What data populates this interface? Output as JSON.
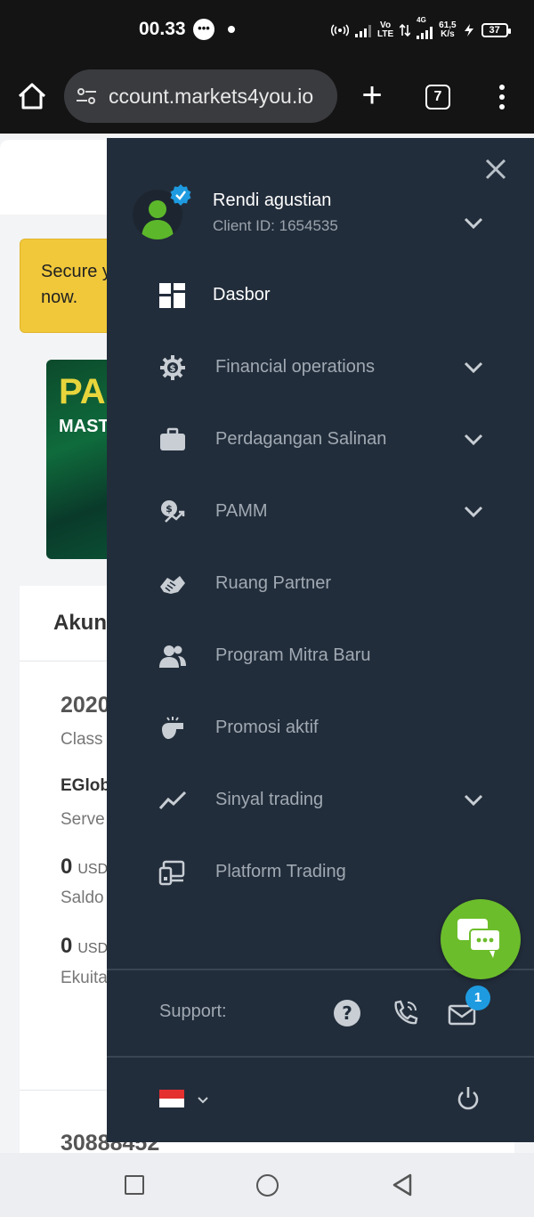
{
  "status_bar": {
    "time": "00.33",
    "network": "Vo\nLTE",
    "signal_type": "4G",
    "speed": "61,5\nK/s",
    "battery": "37"
  },
  "browser": {
    "url": "ccount.markets4you.io",
    "tab_count": "7"
  },
  "background_page": {
    "alert_text": "Secure y\nnow.",
    "banner_title": "PA",
    "banner_subtitle": "MAST",
    "card_title": "Akun",
    "accounts": [
      {
        "number": "2020",
        "type": "Class",
        "server_name": "EGlob",
        "server_label": "Serve",
        "balance": "0",
        "balance_currency": "USD",
        "balance_label": "Saldo",
        "equity": "0",
        "equity_currency": "USD",
        "equity_label": "Ekuita"
      },
      {
        "number": "30888452"
      }
    ]
  },
  "drawer": {
    "user": {
      "name": "Rendi agustian",
      "client_id": "Client ID: 1654535"
    },
    "nav_items": [
      {
        "label": "Dasbor",
        "icon": "dashboard-icon",
        "active": true,
        "has_chevron": false
      },
      {
        "label": "Financial operations",
        "icon": "financial-gear-icon",
        "active": false,
        "has_chevron": true
      },
      {
        "label": "Perdagangan Salinan",
        "icon": "briefcase-icon",
        "active": false,
        "has_chevron": true
      },
      {
        "label": "PAMM",
        "icon": "pamm-money-icon",
        "active": false,
        "has_chevron": true
      },
      {
        "label": "Ruang Partner",
        "icon": "handshake-icon",
        "active": false,
        "has_chevron": false
      },
      {
        "label": "Program Mitra Baru",
        "icon": "users-icon",
        "active": false,
        "has_chevron": false
      },
      {
        "label": "Promosi aktif",
        "icon": "whistle-icon",
        "active": false,
        "has_chevron": false
      },
      {
        "label": "Sinyal trading",
        "icon": "trend-line-icon",
        "active": false,
        "has_chevron": true
      },
      {
        "label": "Platform Trading",
        "icon": "devices-icon",
        "active": false,
        "has_chevron": false
      }
    ],
    "support": {
      "label": "Support:",
      "mail_badge": "1"
    }
  },
  "colors": {
    "drawer_bg": "#222d3b",
    "chat_green": "#6cbd2b",
    "badge_blue": "#1e9be0",
    "alert_yellow": "#f0c83a"
  }
}
